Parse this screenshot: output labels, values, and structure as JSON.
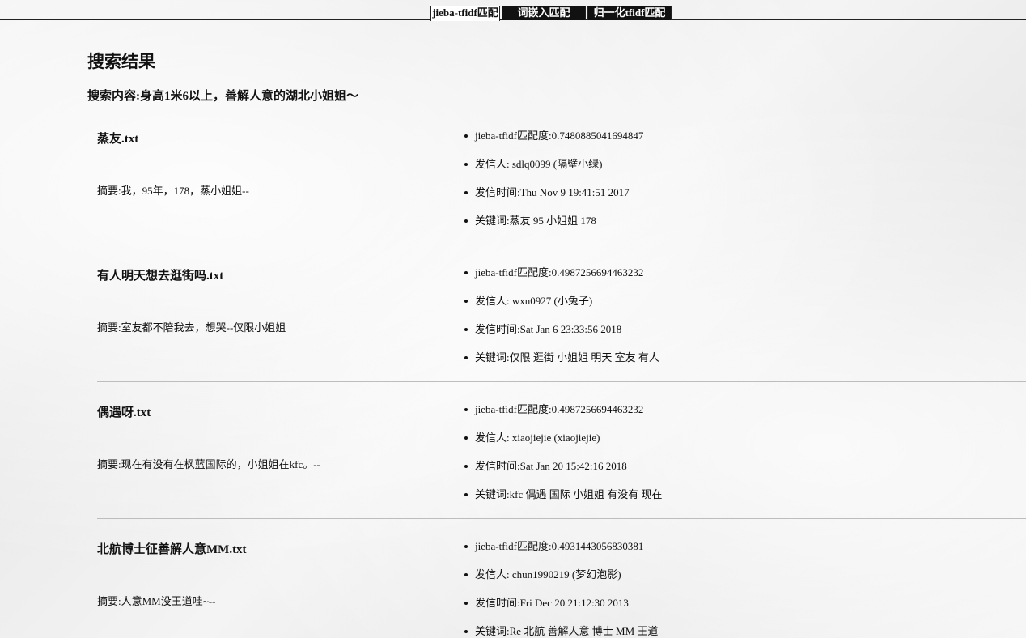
{
  "tabs": [
    {
      "label": "jieba-tfidf匹配",
      "active": true
    },
    {
      "label": "词嵌入匹配",
      "active": false
    },
    {
      "label": "归一化tfidf匹配",
      "active": false
    }
  ],
  "page_title": "搜索结果",
  "query": "搜索内容:身高1米6以上，善解人意的湖北小姐姐～",
  "results": [
    {
      "title": "蒸友.txt",
      "summary": "摘要:我，95年，178，蒸小姐姐--",
      "score": "jieba-tfidf匹配度:0.7480885041694847",
      "sender": "发信人: sdlq0099 (隔壁小绿)",
      "time": "发信时间:Thu Nov 9 19:41:51 2017",
      "keywords": "关键词:蒸友 95 小姐姐 178"
    },
    {
      "title": "有人明天想去逛街吗.txt",
      "summary": "摘要:室友都不陪我去，想哭--仅限小姐姐",
      "score": "jieba-tfidf匹配度:0.4987256694463232",
      "sender": "发信人: wxn0927 (小兔子)",
      "time": "发信时间:Sat Jan 6 23:33:56 2018",
      "keywords": "关键词:仅限 逛街 小姐姐 明天 室友 有人"
    },
    {
      "title": "偶遇呀.txt",
      "summary": "摘要:现在有没有在枫蓝国际的，小姐姐在kfc。--",
      "score": "jieba-tfidf匹配度:0.4987256694463232",
      "sender": "发信人: xiaojiejie (xiaojiejie)",
      "time": "发信时间:Sat Jan 20 15:42:16 2018",
      "keywords": "关键词:kfc 偶遇 国际 小姐姐 有没有 现在"
    },
    {
      "title": "北航博士征善解人意MM.txt",
      "summary": "摘要:人意MM没王道哇~--",
      "score": "jieba-tfidf匹配度:0.4931443056830381",
      "sender": "发信人: chun1990219 (梦幻泡影)",
      "time": "发信时间:Fri Dec 20 21:12:30 2013",
      "keywords": "关键词:Re 北航 善解人意 博士 MM 王道"
    }
  ]
}
